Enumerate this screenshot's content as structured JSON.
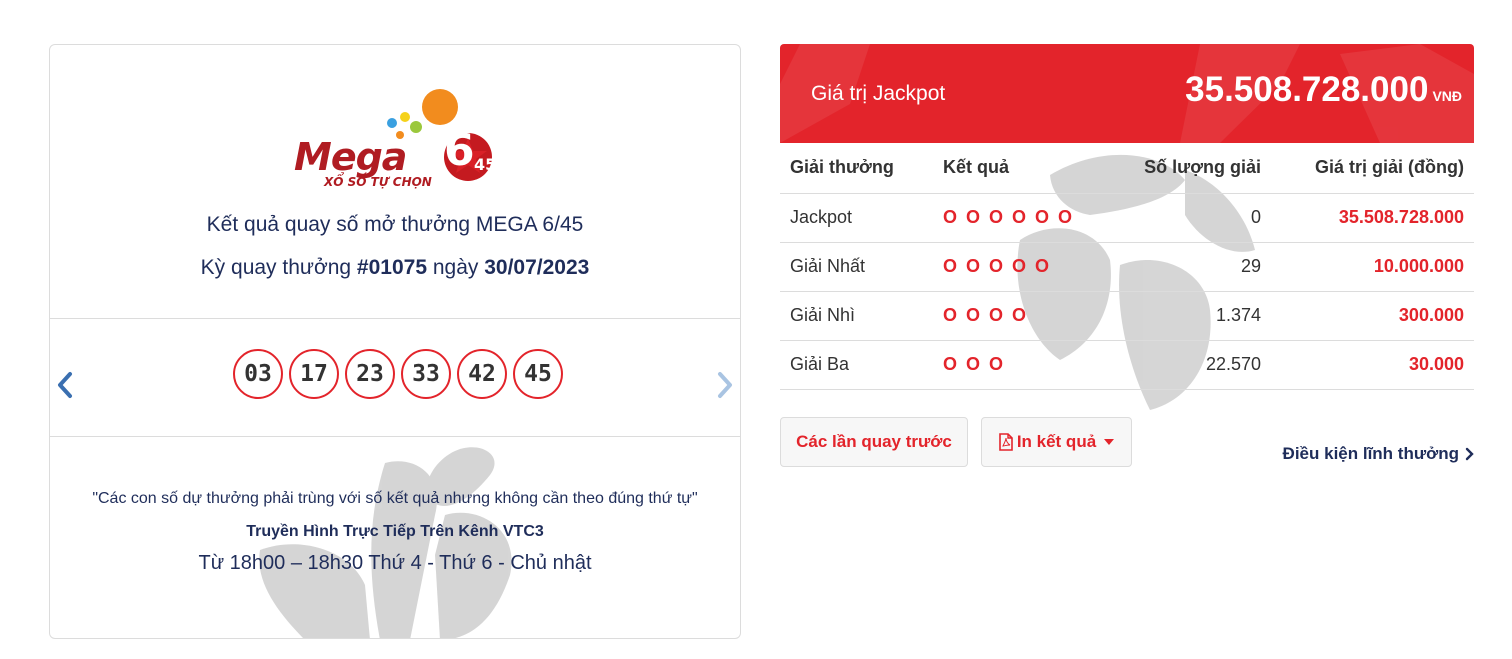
{
  "left": {
    "logo": {
      "brand": "Mega",
      "number_big": "6",
      "number_small": "45",
      "tagline": "XỔ SỐ TỰ CHỌN"
    },
    "title": "Kết quả quay số mở thưởng MEGA 6/45",
    "draw": {
      "prefix": "Kỳ quay thưởng ",
      "number": "#01075",
      "middle": " ngày ",
      "date": "30/07/2023"
    },
    "balls": [
      "03",
      "17",
      "23",
      "33",
      "42",
      "45"
    ],
    "note": {
      "quote": "\"Các con số dự thưởng phải trùng với số kết quả nhưng không cần theo đúng thứ tự\"",
      "channel": "Truyền Hình Trực Tiếp Trên Kênh VTC3",
      "time": "Từ 18h00 – 18h30 Thứ 4 - Thứ 6 - Chủ nhật"
    }
  },
  "jackpot": {
    "label": "Giá trị Jackpot",
    "amount": "35.508.728.000",
    "currency": "VNĐ"
  },
  "table": {
    "headers": [
      "Giải thưởng",
      "Kết quả",
      "Số lượng giải",
      "Giá trị giải (đồng)"
    ],
    "rows": [
      {
        "prize": "Jackpot",
        "result": "O O O O O O",
        "count": "0",
        "value": "35.508.728.000"
      },
      {
        "prize": "Giải Nhất",
        "result": "O O O O O",
        "count": "29",
        "value": "10.000.000"
      },
      {
        "prize": "Giải Nhì",
        "result": "O O O O",
        "count": "1.374",
        "value": "300.000"
      },
      {
        "prize": "Giải Ba",
        "result": "O O O",
        "count": "22.570",
        "value": "30.000"
      }
    ]
  },
  "buttons": {
    "previous": "Các lần quay trước",
    "print": "In kết quả"
  },
  "link": {
    "conditions": "Điều kiện lĩnh thưởng"
  },
  "colors": {
    "accent": "#e3242b",
    "navy": "#1f2d5a",
    "border": "#dcdcdc"
  }
}
